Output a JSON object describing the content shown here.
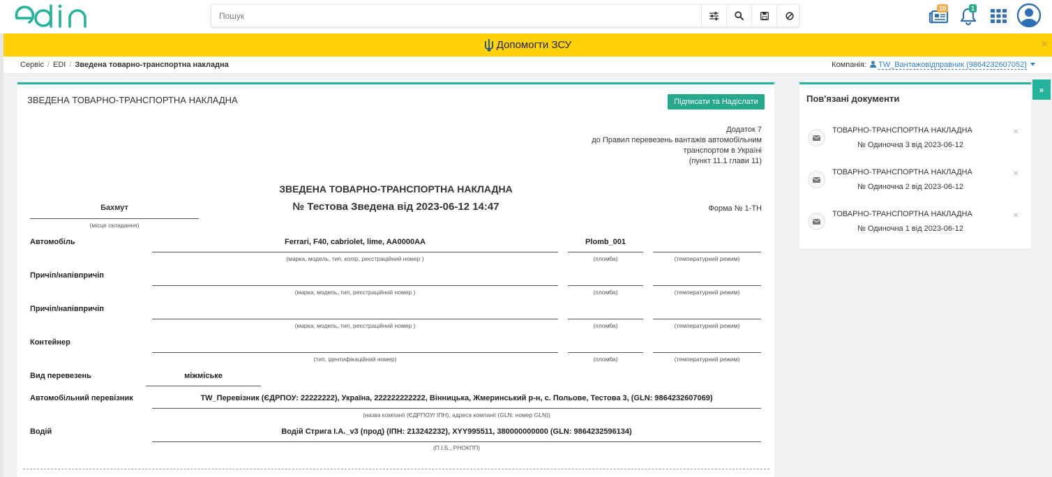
{
  "app": {
    "logo_text": "edin"
  },
  "search": {
    "placeholder": "Пошук"
  },
  "header": {
    "news_badge": "10",
    "notif_badge": "1",
    "colors": {
      "brand": "#22b39a",
      "news_badge": "#f0ad4e",
      "notif_badge": "#26a88a",
      "icon": "#2f6fb3"
    }
  },
  "banner": {
    "text": "Допомогти ЗСУ",
    "close": "×",
    "color": "#fed103"
  },
  "breadcrumbs": {
    "items": [
      "Сервіс",
      "EDI"
    ],
    "current": "Зведена товарно-транспортна накладна",
    "company_label": "Компанія:",
    "company_value": "TW_Вантажовідправник (9864232607052)"
  },
  "document": {
    "panel_title": "ЗВЕДЕНА ТОВАРНО-ТРАНСПОРТНА НАКЛАДНА",
    "sign_button": "Підписати та Надіслати",
    "appendix": [
      "Додаток 7",
      "до Правил перевезень вантажів автомобільним",
      "транспортом в Україні",
      "(пункт 11.1 глави 11)"
    ],
    "form_title": "ЗВЕДЕНА ТОВАРНО-ТРАНСПОРТНА НАКЛАДНА",
    "form_subtitle": "№ Тестова Зведена від 2023-06-12 14:47",
    "form_number": "Форма № 1-ТН",
    "place": {
      "value": "Бахмут",
      "caption": "(місце складання)"
    },
    "car": {
      "label": "Автомобіль",
      "value": "Ferrari, F40, cabriolet, lime, AA0000AA",
      "caption": "(марка, модель, тип, колір, реєстраційний номер )",
      "seal": "Plomb_001",
      "seal_caption": "(пломба)",
      "temp": "",
      "temp_caption": "(температурний режим)"
    },
    "trailer1": {
      "label": "Причіп/напівпричіп",
      "value": "",
      "caption": "(марка, модель, тип, реєстраційний номер )",
      "seal": "",
      "seal_caption": "(пломба)",
      "temp": "",
      "temp_caption": "(температурний режим)"
    },
    "trailer2": {
      "label": "Причіп/напівпричіп",
      "value": "",
      "caption": "(марка, модель, тип, реєстраційний номер )",
      "seal": "",
      "seal_caption": "(пломба)",
      "temp": "",
      "temp_caption": "(температурний режим)"
    },
    "container": {
      "label": "Контейнер",
      "value": "",
      "caption": "(тип, ідентифікаційний номер)",
      "seal": "",
      "seal_caption": "(пломба)",
      "temp": "",
      "temp_caption": "(температурний режим)"
    },
    "transport_type": {
      "label": "Вид перевезень",
      "value": "міжміське"
    },
    "carrier": {
      "label": "Автомобільний перевізник",
      "value": "TW_Перевізник (ЄДРПОУ: 22222222), Україна, 222222222222, Вінницька, Жмеринський р-н, с. Польове, Тестова 3, (GLN: 9864232607069)",
      "caption": "(назва компанії (ЄДРПОУ/ ІПН), адреса компанії (GLN: номер GLN))"
    },
    "driver": {
      "label": "Водій",
      "value": "Водій Стрига І.А._v3 (прод) (ІПН: 213242232), XYY995511, 380000000000 (GLN: 9864232596134)",
      "caption": "(П.І.Б., РНОКПП)"
    }
  },
  "related": {
    "title": "Пов'язані документи",
    "items": [
      {
        "name": "ТОВАРНО-ТРАНСПОРТНА НАКЛАДНА",
        "sub": "№ Одиночна 3 від 2023-06-12"
      },
      {
        "name": "ТОВАРНО-ТРАНСПОРТНА НАКЛАДНА",
        "sub": "№ Одиночна 2 від 2023-06-12"
      },
      {
        "name": "ТОВАРНО-ТРАНСПОРТНА НАКЛАДНА",
        "sub": "№ Одиночна 1 від 2023-06-12"
      }
    ],
    "close": "×",
    "collapse": "»"
  }
}
